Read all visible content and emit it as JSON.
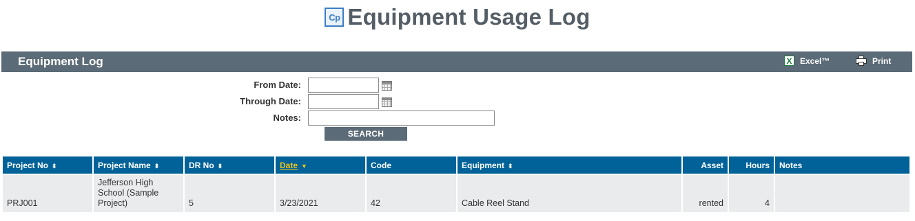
{
  "header": {
    "logo_text": "Cp",
    "title": "Equipment Usage Log"
  },
  "panel": {
    "title": "Equipment Log",
    "excel_label": "Excel™",
    "print_label": "Print"
  },
  "filters": {
    "from_date_label": "From Date:",
    "from_date_value": "",
    "through_date_label": "Through Date:",
    "through_date_value": "",
    "notes_label": "Notes:",
    "notes_value": "",
    "search_label": "SEARCH"
  },
  "table": {
    "columns": [
      {
        "label": "Project No",
        "sort": "⬍"
      },
      {
        "label": "Project Name",
        "sort": "⬍"
      },
      {
        "label": "DR No",
        "sort": "⬍"
      },
      {
        "label": "Date",
        "sort": "▼"
      },
      {
        "label": "Code",
        "sort": ""
      },
      {
        "label": "Equipment",
        "sort": "⬍"
      },
      {
        "label": "Asset",
        "sort": ""
      },
      {
        "label": "Hours",
        "sort": ""
      },
      {
        "label": "Notes",
        "sort": ""
      }
    ],
    "rows": [
      {
        "project_no": "PRJ001",
        "project_name": "Jefferson High School (Sample Project)",
        "dr_no": "5",
        "date": "3/23/2021",
        "code": "42",
        "equipment": "Cable Reel Stand",
        "asset": "rented",
        "hours": "4",
        "notes": ""
      }
    ]
  }
}
